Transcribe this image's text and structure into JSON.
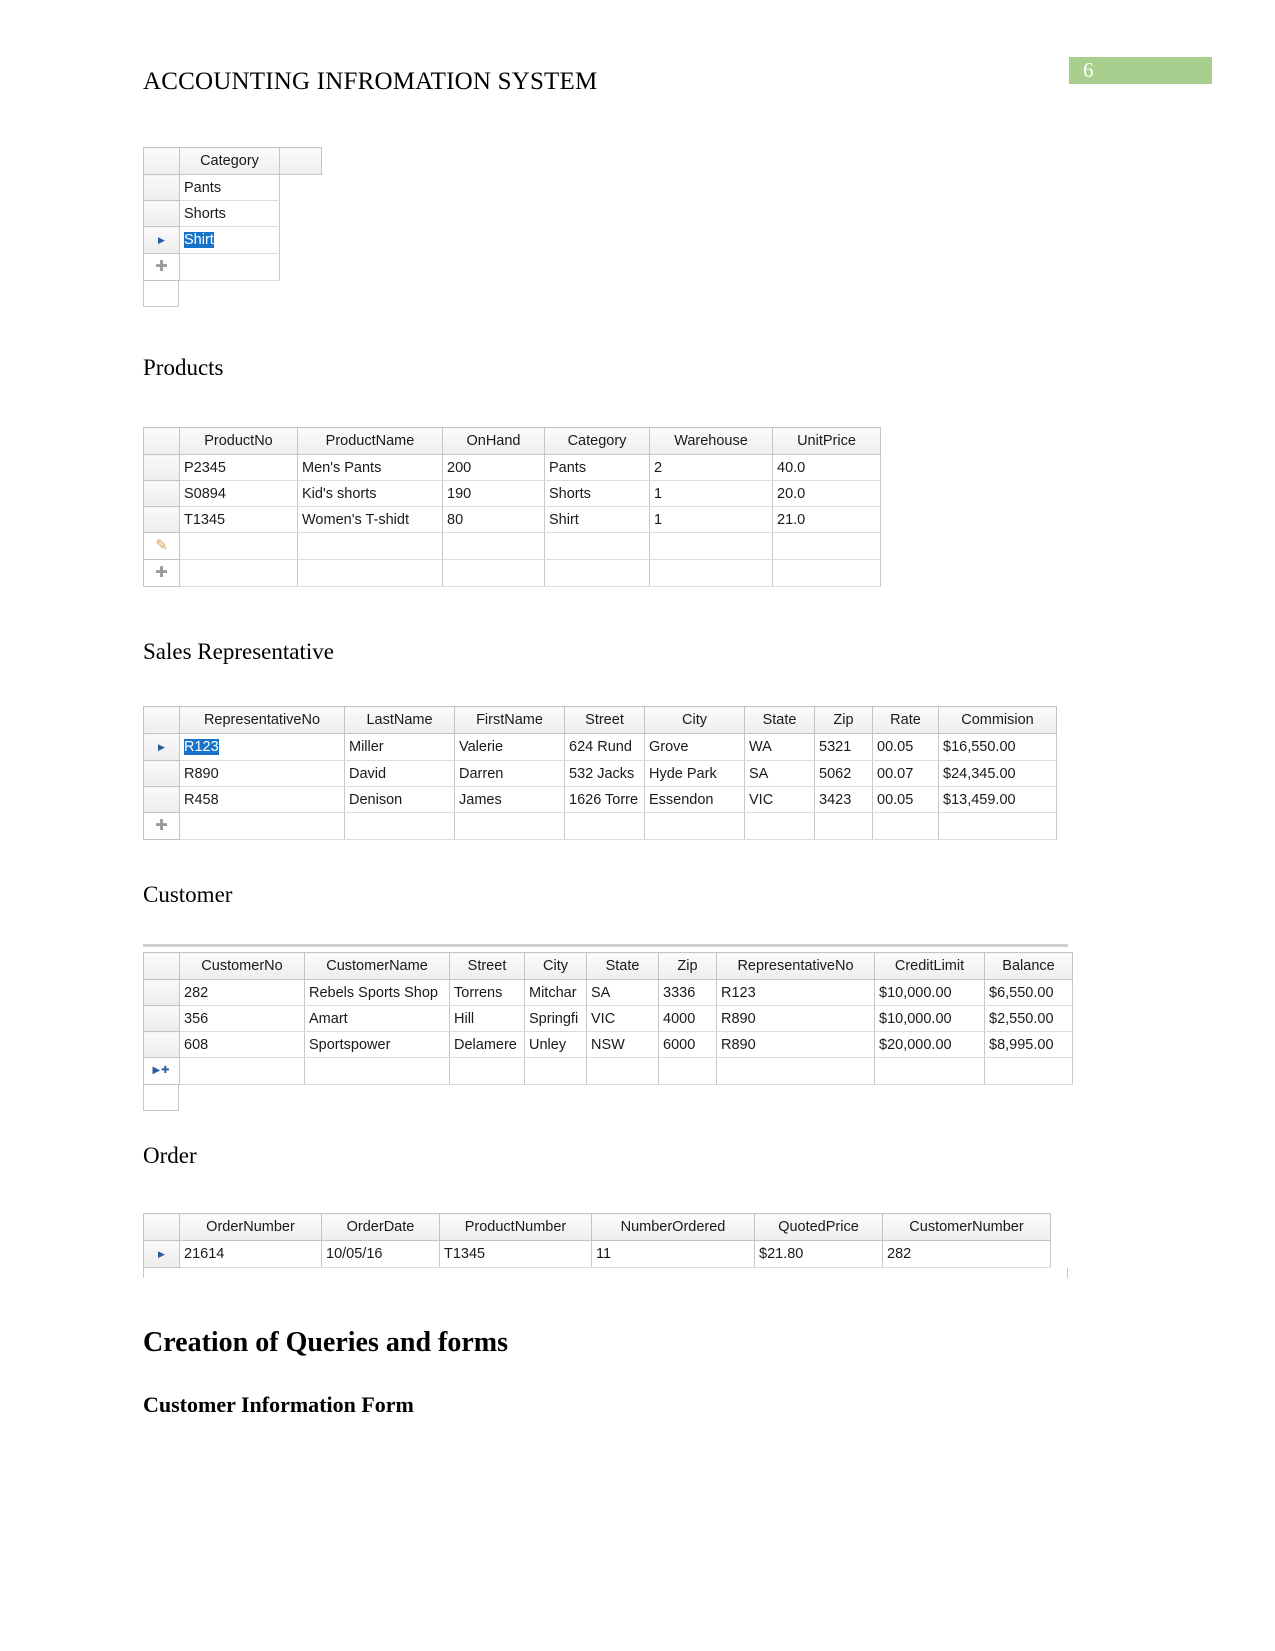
{
  "document": {
    "header_title": "ACCOUNTING INFROMATION SYSTEM",
    "page_number": "6",
    "badge_color": "#a9cf8e"
  },
  "sections": {
    "category_caption": "",
    "products_caption": "Products",
    "sales_rep_caption": "Sales Representative",
    "customer_caption": "Customer",
    "order_caption": "Order",
    "queries_heading": "Creation of Queries and forms",
    "customer_form_heading": "Customer Information Form"
  },
  "category_table": {
    "columns": [
      "Category"
    ],
    "rows": [
      {
        "category": "Pants",
        "marker": "",
        "selected": false
      },
      {
        "category": "Shorts",
        "marker": "",
        "selected": false
      },
      {
        "category": "Shirt",
        "marker": "arrow",
        "selected": true
      }
    ],
    "new_row_marker": "plus"
  },
  "products_table": {
    "columns": [
      "ProductNo",
      "ProductName",
      "OnHand",
      "Category",
      "Warehouse",
      "UnitPrice"
    ],
    "rows": [
      [
        "P2345",
        "Men's Pants",
        "200",
        "Pants",
        "2",
        "40.0"
      ],
      [
        "S0894",
        "Kid's shorts",
        "190",
        "Shorts",
        "1",
        "20.0"
      ],
      [
        "T1345",
        "Women's T-shidt",
        "80",
        "Shirt",
        "1",
        "21.0"
      ]
    ],
    "edit_row_marker": "pencil",
    "new_row_marker": "plus"
  },
  "sales_rep_table": {
    "columns": [
      "RepresentativeNo",
      "LastName",
      "FirstName",
      "Street",
      "City",
      "State",
      "Zip",
      "Rate",
      "Commision"
    ],
    "rows": [
      {
        "marker": "arrow",
        "selected_cell": 0,
        "values": [
          "R123",
          "Miller",
          "Valerie",
          "624 Rund",
          "Grove",
          "WA",
          "5321",
          "00.05",
          "$16,550.00"
        ]
      },
      {
        "marker": "",
        "selected_cell": -1,
        "values": [
          "R890",
          "David",
          "Darren",
          "532 Jacks",
          "Hyde Park",
          "SA",
          "5062",
          "00.07",
          "$24,345.00"
        ]
      },
      {
        "marker": "",
        "selected_cell": -1,
        "values": [
          "R458",
          "Denison",
          "James",
          "1626 Torre",
          "Essendon",
          "VIC",
          "3423",
          "00.05",
          "$13,459.00"
        ]
      }
    ],
    "new_row_marker": "plus"
  },
  "customer_table": {
    "columns": [
      "CustomerNo",
      "CustomerName",
      "Street",
      "City",
      "State",
      "Zip",
      "RepresentativeNo",
      "CreditLimit",
      "Balance"
    ],
    "rows": [
      [
        "282",
        "Rebels Sports Shop",
        "Torrens",
        "Mitchar",
        "SA",
        "3336",
        "R123",
        "$10,000.00",
        "$6,550.00"
      ],
      [
        "356",
        "Amart",
        "Hill",
        "Springfi",
        "VIC",
        "4000",
        "R890",
        "$10,000.00",
        "$2,550.00"
      ],
      [
        "608",
        "Sportspower",
        "Delamere",
        "Unley",
        "NSW",
        "6000",
        "R890",
        "$20,000.00",
        "$8,995.00"
      ]
    ],
    "new_row_marker": "arrowplus"
  },
  "order_table": {
    "columns": [
      "OrderNumber",
      "OrderDate",
      "ProductNumber",
      "NumberOrdered",
      "QuotedPrice",
      "CustomerNumber"
    ],
    "rows": [
      {
        "marker": "arrow",
        "values": [
          "21614",
          "10/05/16",
          "T1345",
          "11",
          "$21.80",
          "282"
        ]
      }
    ]
  }
}
